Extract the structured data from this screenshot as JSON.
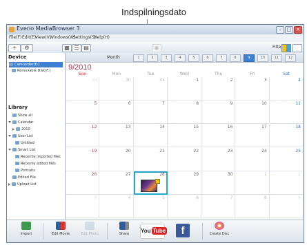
{
  "callout": {
    "label": "Indspilningsdato"
  },
  "window": {
    "title": "Everio MediaBrowser 3",
    "menu": [
      "File(F)",
      "Edit(E)",
      "View(V)",
      "Windows(W)",
      "Settings(S)",
      "Help(H)"
    ],
    "buttons": {
      "minimize": "–",
      "maximize": "□",
      "close": "✕"
    }
  },
  "toolbar": {
    "add": "+",
    "filter_label": "Filter"
  },
  "sidebar": {
    "device_header": "Device",
    "devices": [
      {
        "label": "Camcorder(E:)",
        "selected": true
      },
      {
        "label": "Removable Disk(F:)",
        "selected": false
      }
    ],
    "library_header": "Library",
    "library": [
      {
        "label": "Show all"
      },
      {
        "label": "Calendar"
      },
      {
        "label": "2010"
      },
      {
        "label": "User List"
      },
      {
        "label": "Untitled"
      },
      {
        "label": "Smart List"
      },
      {
        "label": "Recently imported files"
      },
      {
        "label": "Recently edited files"
      },
      {
        "label": "Portraits"
      },
      {
        "label": "Edited File"
      },
      {
        "label": "Upload List"
      }
    ]
  },
  "calendar": {
    "month_label": "Month",
    "months": [
      "1",
      "2",
      "3",
      "4",
      "5",
      "6",
      "7",
      "8",
      "9",
      "10",
      "11",
      "12"
    ],
    "selected_month": "9",
    "year_month": "9/2010",
    "weekdays": [
      "Sun",
      "Mon",
      "Tue",
      "Wed",
      "Thu",
      "Fri",
      "Sat"
    ],
    "weeks": [
      [
        "29",
        "30",
        "31",
        "1",
        "2",
        "3",
        "4"
      ],
      [
        "5",
        "6",
        "7",
        "8",
        "9",
        "10",
        "11"
      ],
      [
        "12",
        "13",
        "14",
        "15",
        "16",
        "17",
        "18"
      ],
      [
        "19",
        "20",
        "21",
        "22",
        "23",
        "24",
        "25"
      ],
      [
        "26",
        "27",
        "28",
        "29",
        "30",
        "1",
        "2"
      ],
      [
        "3",
        "4",
        "5",
        "6",
        "7",
        "8",
        "9"
      ]
    ],
    "highlighted_day": "28"
  },
  "bottom_bar": {
    "items": [
      "Import",
      "Edit Movie",
      "Edit Photo",
      "Share",
      "YouTube",
      "Facebook",
      "Create Disc"
    ],
    "youtube_you": "You",
    "youtube_tube": "Tube",
    "facebook": "f"
  },
  "colors": {
    "accent": "#27a7c7",
    "selection": "#3d7fd3",
    "sunday": "#c33",
    "year_month": "#b7314b"
  }
}
